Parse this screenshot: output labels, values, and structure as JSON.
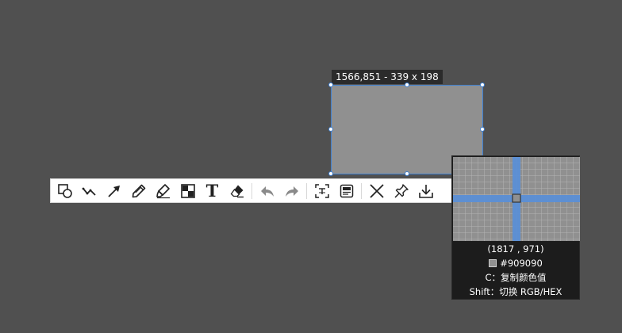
{
  "selection": {
    "size_label": "1566,851 - 339 x 198",
    "fill_color": "#909090",
    "border_color": "#3e7fd0"
  },
  "toolbar": {
    "tools": [
      {
        "name": "shape-tool",
        "icon": "shapes-icon"
      },
      {
        "name": "polyline-tool",
        "icon": "polyline-icon"
      },
      {
        "name": "arrow-tool",
        "icon": "arrow-icon"
      },
      {
        "name": "pencil-tool",
        "icon": "pencil-icon"
      },
      {
        "name": "highlighter-tool",
        "icon": "highlighter-icon"
      },
      {
        "name": "mosaic-tool",
        "icon": "mosaic-icon"
      },
      {
        "name": "text-tool",
        "icon": "text-icon",
        "glyph": "T"
      },
      {
        "name": "eraser-tool",
        "icon": "eraser-icon"
      },
      {
        "name": "undo-button",
        "icon": "undo-icon"
      },
      {
        "name": "redo-button",
        "icon": "redo-icon"
      },
      {
        "name": "ocr-button",
        "icon": "ocr-icon"
      },
      {
        "name": "gif-button",
        "icon": "gif-icon"
      },
      {
        "name": "close-button",
        "icon": "close-icon"
      },
      {
        "name": "pin-button",
        "icon": "pin-icon"
      },
      {
        "name": "save-button",
        "icon": "download-icon"
      }
    ]
  },
  "magnifier": {
    "coords": "(1817 , 971)",
    "color_hex": "#909090",
    "copy_hint": "C：复制颜色值",
    "switch_hint": "Shift：切换 RGB/HEX",
    "crosshair_color": "#5b8fd6"
  }
}
